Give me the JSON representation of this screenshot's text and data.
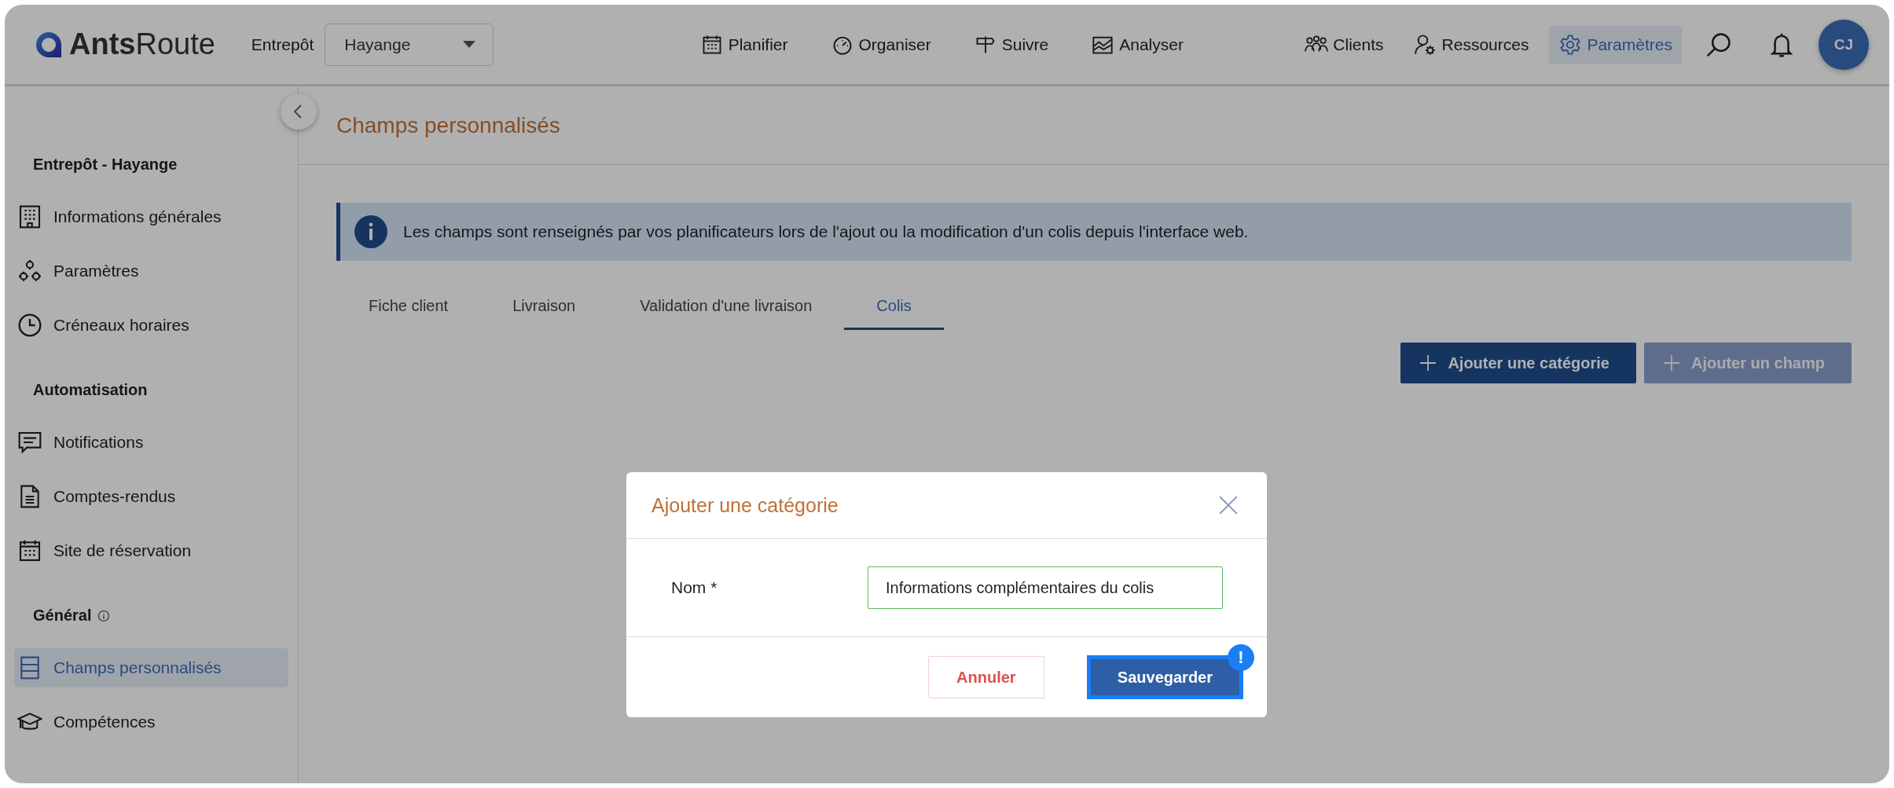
{
  "brand": {
    "name": "**Ants**Route"
  },
  "header": {
    "warehouse_label": "Entrepôt",
    "warehouse_value": "Hayange",
    "nav": [
      {
        "label": "Planifier",
        "selected": false
      },
      {
        "label": "Organiser",
        "selected": false
      },
      {
        "label": "Suivre",
        "selected": false
      },
      {
        "label": "Analyser",
        "selected": false
      }
    ],
    "right_nav": [
      {
        "label": "Clients",
        "selected": false
      },
      {
        "label": "Ressources",
        "selected": false
      },
      {
        "label": "Paramètres",
        "selected": true
      }
    ],
    "avatar": "CJ"
  },
  "sidebar": {
    "sections": [
      {
        "title": "Entrepôt - Hayange",
        "has_info": false,
        "items": [
          {
            "label": "Informations générales",
            "selected": false
          },
          {
            "label": "Paramètres",
            "selected": false
          },
          {
            "label": "Créneaux horaires",
            "selected": false
          }
        ]
      },
      {
        "title": "Automatisation",
        "has_info": false,
        "items": [
          {
            "label": "Notifications",
            "selected": false
          },
          {
            "label": "Comptes-rendus",
            "selected": false
          },
          {
            "label": "Site de réservation",
            "selected": false
          }
        ]
      },
      {
        "title": "Général",
        "has_info": true,
        "items": [
          {
            "label": "Champs personnalisés",
            "selected": true
          },
          {
            "label": "Compétences",
            "selected": false
          }
        ]
      }
    ]
  },
  "page": {
    "title": "Champs personnalisés",
    "banner": "Les champs sont renseignés par vos planificateurs lors de l'ajout ou la modification d'un colis depuis l'interface web.",
    "tabs": [
      {
        "label": "Fiche client",
        "selected": false
      },
      {
        "label": "Livraison",
        "selected": false
      },
      {
        "label": "Validation d'une livraison",
        "selected": false
      },
      {
        "label": "Colis",
        "selected": true
      }
    ],
    "actions": [
      {
        "label": "Ajouter une catégorie",
        "disabled": false
      },
      {
        "label": "Ajouter un champ",
        "disabled": true
      }
    ]
  },
  "modal": {
    "title": "Ajouter une catégorie",
    "field_label": "Nom *",
    "field_value": "Informations complémentaires du colis",
    "cancel": "Annuler",
    "save": "Sauvegarder",
    "save_badge": "!"
  }
}
